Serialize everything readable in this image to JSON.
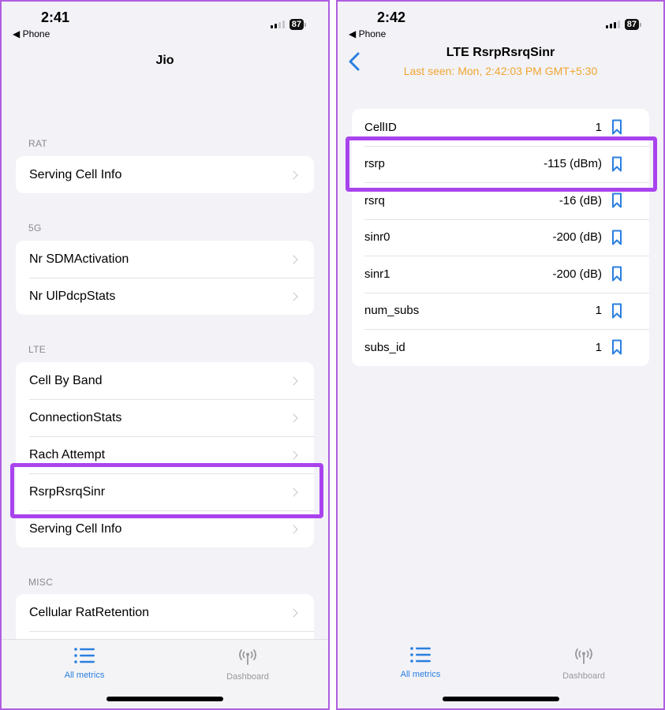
{
  "left_screen": {
    "status_bar": {
      "time": "2:41",
      "back_app": "◀ Phone",
      "battery": "87"
    },
    "nav": {
      "title": "Jio"
    },
    "sections": [
      {
        "header": "RAT",
        "items": [
          {
            "label": "Serving Cell Info"
          }
        ]
      },
      {
        "header": "5G",
        "items": [
          {
            "label": "Nr SDMActivation"
          },
          {
            "label": "Nr UlPdcpStats"
          }
        ]
      },
      {
        "header": "LTE",
        "items": [
          {
            "label": "Cell By Band"
          },
          {
            "label": "ConnectionStats"
          },
          {
            "label": "Rach Attempt"
          },
          {
            "label": "RsrpRsrqSinr",
            "highlighted": true
          },
          {
            "label": "Serving Cell Info"
          }
        ]
      },
      {
        "header": "MISC",
        "items": [
          {
            "label": "Cellular RatRetention"
          }
        ]
      }
    ],
    "tabbar": {
      "tabs": [
        {
          "label": "All metrics",
          "icon": "list-icon",
          "active": true
        },
        {
          "label": "Dashboard",
          "icon": "antenna-icon",
          "active": false
        }
      ]
    }
  },
  "right_screen": {
    "status_bar": {
      "time": "2:42",
      "back_app": "◀ Phone",
      "battery": "87"
    },
    "nav": {
      "title": "LTE RsrpRsrqSinr",
      "subtitle": "Last seen: Mon, 2:42:03 PM GMT+5:30",
      "back_icon": "chevron-left-icon"
    },
    "metrics": [
      {
        "label": "CellID",
        "value": "1"
      },
      {
        "label": "rsrp",
        "value": "-115 (dBm)",
        "highlighted": true
      },
      {
        "label": "rsrq",
        "value": "-16 (dB)"
      },
      {
        "label": "sinr0",
        "value": "-200 (dB)"
      },
      {
        "label": "sinr1",
        "value": "-200 (dB)"
      },
      {
        "label": "num_subs",
        "value": "1"
      },
      {
        "label": "subs_id",
        "value": "1"
      }
    ],
    "tabbar": {
      "tabs": [
        {
          "label": "All metrics",
          "icon": "list-icon",
          "active": true
        },
        {
          "label": "Dashboard",
          "icon": "antenna-icon",
          "active": false
        }
      ]
    }
  },
  "colors": {
    "accent": "#2a7fe0",
    "highlight": "#a943ee",
    "subtitle": "#f2a531",
    "background": "#f2f2f7"
  }
}
